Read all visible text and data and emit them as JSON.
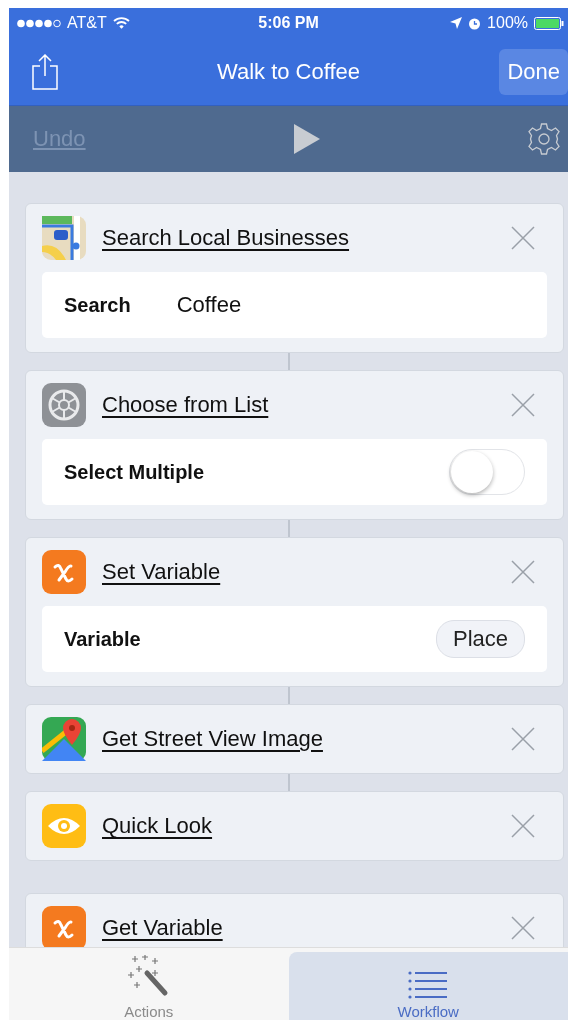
{
  "status_bar": {
    "carrier": "AT&T",
    "time": "5:06 PM",
    "battery": "100%"
  },
  "nav_bar": {
    "title": "Walk to Coffee",
    "done": "Done"
  },
  "toolbar": {
    "undo": {
      "label": "Undo",
      "disabled": true
    }
  },
  "actions": [
    {
      "title": "Search Local Businesses",
      "param": {
        "kind": "text",
        "label": "Search",
        "value": "Coffee"
      }
    },
    {
      "title": "Choose from List",
      "param": {
        "kind": "toggle",
        "label": "Select Multiple",
        "on": false
      }
    },
    {
      "title": "Set Variable",
      "param": {
        "kind": "token",
        "label": "Variable",
        "value": "Place"
      }
    },
    {
      "title": "Get Street View Image"
    },
    {
      "title": "Quick Look"
    },
    {
      "title": "Get Variable"
    }
  ],
  "tabs": [
    {
      "label": "Actions",
      "selected": false
    },
    {
      "label": "Workflow",
      "selected": true
    }
  ]
}
